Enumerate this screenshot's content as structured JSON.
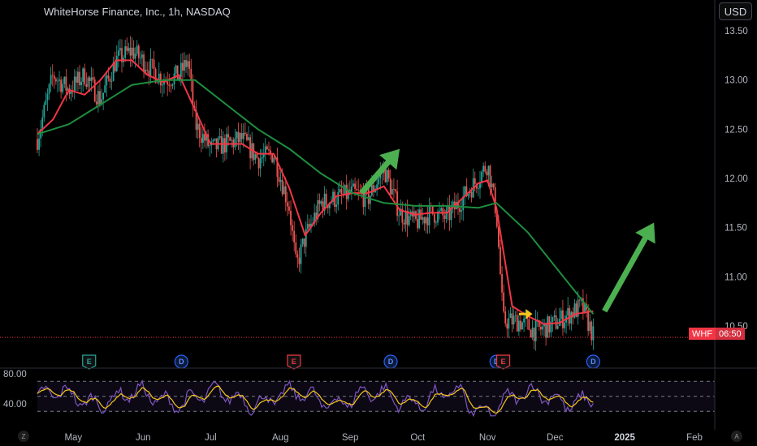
{
  "header": {
    "title": "WhiteHorse Finance, Inc., 1h, NASDAQ",
    "currency": "USD"
  },
  "price_label": {
    "symbol": "WHF",
    "countdown": "06:50"
  },
  "corner_buttons": {
    "left": "Z",
    "right": "A"
  },
  "colors": {
    "ema_fast": "#f23645",
    "sma_slow": "#1e8e3e",
    "arrow": "#4caf50",
    "arrow_small": "#f5c518",
    "rsi": "#7e57c2",
    "rsi_signal": "#f5c518",
    "earnings": "#26a69a",
    "earnings_red": "#f23645",
    "dividend": "#2962ff",
    "price_line": "#f23645"
  },
  "events": [
    {
      "type": "earnings",
      "label": "E",
      "date": "2024-05-08",
      "color": "#26a69a"
    },
    {
      "type": "dividend",
      "label": "D",
      "date": "2024-06-18"
    },
    {
      "type": "earnings",
      "label": "E",
      "date": "2024-08-07",
      "color": "#f23645"
    },
    {
      "type": "dividend",
      "label": "D",
      "date": "2024-09-19"
    },
    {
      "type": "dividend",
      "label": "D",
      "date": "2024-11-05"
    },
    {
      "type": "earnings",
      "label": "E",
      "date": "2024-11-08",
      "color": "#f23645"
    },
    {
      "type": "dividend",
      "label": "D",
      "date": "2024-12-18"
    }
  ],
  "chart_data": [
    {
      "type": "candlestick",
      "title": "WhiteHorse Finance, Inc., 1h, NASDAQ",
      "x_ticks": [
        "May",
        "Jun",
        "Jul",
        "Aug",
        "Sep",
        "Oct",
        "Nov",
        "Dec",
        "2025",
        "Feb"
      ],
      "x_range": [
        "2024-04-15",
        "2025-02-10"
      ],
      "y_ticks": [
        "13.50",
        "13.00",
        "12.50",
        "12.00",
        "11.50",
        "11.00",
        "10.50"
      ],
      "ylim": [
        10.4,
        13.6
      ],
      "last_price": 10.4,
      "price_path": [
        {
          "x": "2024-04-15",
          "y": 12.4
        },
        {
          "x": "2024-04-22",
          "y": 13.05
        },
        {
          "x": "2024-04-29",
          "y": 12.9
        },
        {
          "x": "2024-05-06",
          "y": 13.05
        },
        {
          "x": "2024-05-13",
          "y": 12.8
        },
        {
          "x": "2024-05-20",
          "y": 13.2
        },
        {
          "x": "2024-05-27",
          "y": 13.3
        },
        {
          "x": "2024-06-03",
          "y": 13.15
        },
        {
          "x": "2024-06-10",
          "y": 13.0
        },
        {
          "x": "2024-06-17",
          "y": 13.05
        },
        {
          "x": "2024-06-21",
          "y": 13.2
        },
        {
          "x": "2024-06-24",
          "y": 12.55
        },
        {
          "x": "2024-07-01",
          "y": 12.3
        },
        {
          "x": "2024-07-08",
          "y": 12.35
        },
        {
          "x": "2024-07-15",
          "y": 12.4
        },
        {
          "x": "2024-07-22",
          "y": 12.2
        },
        {
          "x": "2024-07-29",
          "y": 12.25
        },
        {
          "x": "2024-08-05",
          "y": 11.7
        },
        {
          "x": "2024-08-08",
          "y": 11.1
        },
        {
          "x": "2024-08-12",
          "y": 11.4
        },
        {
          "x": "2024-08-19",
          "y": 11.75
        },
        {
          "x": "2024-08-26",
          "y": 11.8
        },
        {
          "x": "2024-09-02",
          "y": 11.85
        },
        {
          "x": "2024-09-09",
          "y": 11.8
        },
        {
          "x": "2024-09-16",
          "y": 12.1
        },
        {
          "x": "2024-09-23",
          "y": 11.65
        },
        {
          "x": "2024-09-30",
          "y": 11.55
        },
        {
          "x": "2024-10-07",
          "y": 11.65
        },
        {
          "x": "2024-10-14",
          "y": 11.6
        },
        {
          "x": "2024-10-21",
          "y": 11.8
        },
        {
          "x": "2024-10-28",
          "y": 12.0
        },
        {
          "x": "2024-11-01",
          "y": 12.15
        },
        {
          "x": "2024-11-05",
          "y": 11.65
        },
        {
          "x": "2024-11-08",
          "y": 10.55
        },
        {
          "x": "2024-11-15",
          "y": 10.55
        },
        {
          "x": "2024-11-22",
          "y": 10.45
        },
        {
          "x": "2024-11-29",
          "y": 10.5
        },
        {
          "x": "2024-12-06",
          "y": 10.6
        },
        {
          "x": "2024-12-13",
          "y": 10.7
        },
        {
          "x": "2024-12-18",
          "y": 10.4
        }
      ],
      "series": [
        {
          "name": "",
          "kind": "ema_fast",
          "points": [
            {
              "x": "2024-04-15",
              "y": 12.45
            },
            {
              "x": "2024-04-22",
              "y": 12.6
            },
            {
              "x": "2024-04-29",
              "y": 12.9
            },
            {
              "x": "2024-05-06",
              "y": 12.85
            },
            {
              "x": "2024-05-13",
              "y": 13.0
            },
            {
              "x": "2024-05-20",
              "y": 13.2
            },
            {
              "x": "2024-05-27",
              "y": 13.2
            },
            {
              "x": "2024-06-03",
              "y": 13.05
            },
            {
              "x": "2024-06-10",
              "y": 12.98
            },
            {
              "x": "2024-06-17",
              "y": 13.05
            },
            {
              "x": "2024-06-24",
              "y": 12.7
            },
            {
              "x": "2024-07-01",
              "y": 12.35
            },
            {
              "x": "2024-07-08",
              "y": 12.35
            },
            {
              "x": "2024-07-15",
              "y": 12.35
            },
            {
              "x": "2024-07-22",
              "y": 12.25
            },
            {
              "x": "2024-07-29",
              "y": 12.25
            },
            {
              "x": "2024-08-05",
              "y": 11.9
            },
            {
              "x": "2024-08-12",
              "y": 11.42
            },
            {
              "x": "2024-08-19",
              "y": 11.65
            },
            {
              "x": "2024-08-26",
              "y": 11.82
            },
            {
              "x": "2024-09-02",
              "y": 11.85
            },
            {
              "x": "2024-09-09",
              "y": 11.85
            },
            {
              "x": "2024-09-16",
              "y": 11.92
            },
            {
              "x": "2024-09-23",
              "y": 11.68
            },
            {
              "x": "2024-09-30",
              "y": 11.63
            },
            {
              "x": "2024-10-07",
              "y": 11.65
            },
            {
              "x": "2024-10-14",
              "y": 11.65
            },
            {
              "x": "2024-10-21",
              "y": 11.8
            },
            {
              "x": "2024-10-28",
              "y": 11.95
            },
            {
              "x": "2024-11-01",
              "y": 11.98
            },
            {
              "x": "2024-11-05",
              "y": 11.7
            },
            {
              "x": "2024-11-12",
              "y": 10.7
            },
            {
              "x": "2024-11-19",
              "y": 10.6
            },
            {
              "x": "2024-11-26",
              "y": 10.52
            },
            {
              "x": "2024-12-03",
              "y": 10.53
            },
            {
              "x": "2024-12-10",
              "y": 10.62
            },
            {
              "x": "2024-12-18",
              "y": 10.65
            }
          ]
        },
        {
          "name": "",
          "kind": "sma_slow",
          "points": [
            {
              "x": "2024-04-15",
              "y": 12.45
            },
            {
              "x": "2024-04-29",
              "y": 12.55
            },
            {
              "x": "2024-05-13",
              "y": 12.75
            },
            {
              "x": "2024-05-27",
              "y": 12.95
            },
            {
              "x": "2024-06-10",
              "y": 13.0
            },
            {
              "x": "2024-06-24",
              "y": 13.0
            },
            {
              "x": "2024-07-08",
              "y": 12.75
            },
            {
              "x": "2024-07-22",
              "y": 12.5
            },
            {
              "x": "2024-08-05",
              "y": 12.3
            },
            {
              "x": "2024-08-19",
              "y": 12.05
            },
            {
              "x": "2024-09-02",
              "y": 11.85
            },
            {
              "x": "2024-09-16",
              "y": 11.75
            },
            {
              "x": "2024-09-30",
              "y": 11.72
            },
            {
              "x": "2024-10-14",
              "y": 11.72
            },
            {
              "x": "2024-10-28",
              "y": 11.7
            },
            {
              "x": "2024-11-05",
              "y": 11.75
            },
            {
              "x": "2024-11-19",
              "y": 11.45
            },
            {
              "x": "2024-12-03",
              "y": 11.05
            },
            {
              "x": "2024-12-18",
              "y": 10.62
            }
          ]
        }
      ],
      "annotations": [
        {
          "kind": "arrow-up",
          "from": {
            "x": "2024-09-06",
            "y": 11.85
          },
          "to": {
            "x": "2024-09-23",
            "y": 12.3
          }
        },
        {
          "kind": "arrow-up",
          "from": {
            "x": "2024-12-23",
            "y": 10.65
          },
          "to": {
            "x": "2025-01-14",
            "y": 11.55
          }
        },
        {
          "kind": "arrow-right",
          "from": {
            "x": "2024-11-15",
            "y": 10.62
          },
          "to": {
            "x": "2024-11-21",
            "y": 10.62
          }
        }
      ]
    },
    {
      "type": "line",
      "panel": "oscillator",
      "y_ticks": [
        "80.00",
        "40.00"
      ],
      "ylim": [
        20,
        85
      ],
      "bands": [
        70,
        50,
        30
      ],
      "series": [
        {
          "name": "",
          "kind": "rsi"
        },
        {
          "name": "",
          "kind": "rsi_signal"
        }
      ]
    }
  ]
}
